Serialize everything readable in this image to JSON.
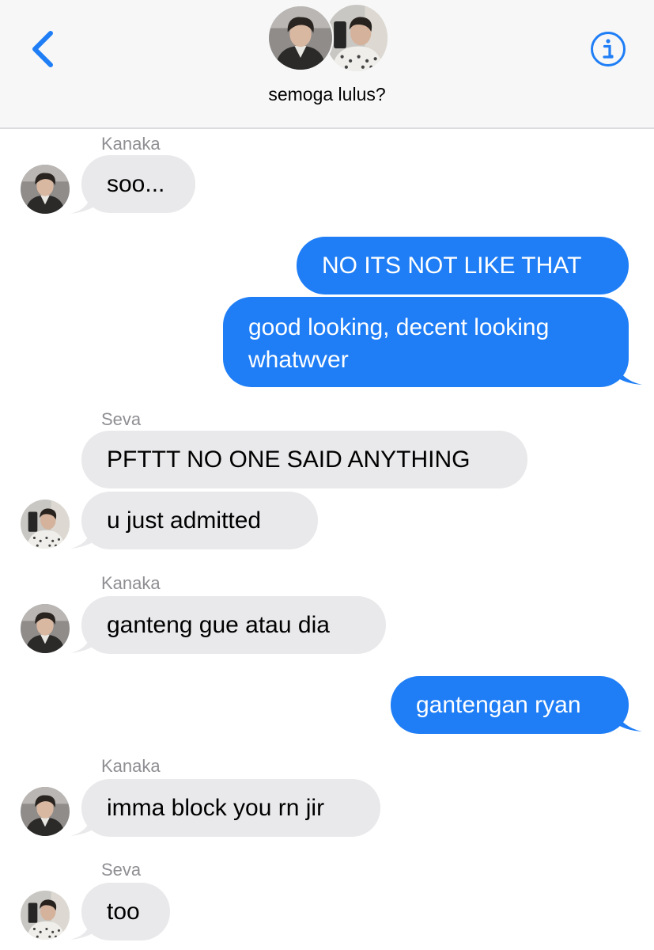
{
  "header": {
    "group_name": "semoga lulus?",
    "accent_color": "#1f7ef6",
    "back_icon": "chevron-left-icon",
    "info_icon": "info-circle-icon"
  },
  "messages": [
    {
      "direction": "incoming",
      "sender": "Kanaka",
      "text": "soo...",
      "tail": true
    },
    {
      "direction": "outgoing",
      "text": "NO ITS NOT LIKE THAT",
      "tail": false
    },
    {
      "direction": "outgoing",
      "text_lines": [
        "good looking, decent looking",
        "whatwver"
      ],
      "tail": true
    },
    {
      "direction": "incoming",
      "sender": "Seva",
      "text": "PFTTT NO ONE SAID ANYTHING",
      "tail": false
    },
    {
      "direction": "incoming",
      "text": "u just admitted",
      "tail": true
    },
    {
      "direction": "incoming",
      "sender": "Kanaka",
      "text": "ganteng gue atau dia",
      "tail": true
    },
    {
      "direction": "outgoing",
      "text": "gantengan ryan",
      "tail": true
    },
    {
      "direction": "incoming",
      "sender": "Kanaka",
      "text": "imma block you rn jir",
      "tail": true
    },
    {
      "direction": "incoming",
      "sender": "Seva",
      "text": "too",
      "tail": true
    }
  ],
  "colors": {
    "incoming_bubble": "#e9e9eb",
    "outgoing_bubble": "#1f7ef6",
    "sender_label": "#8e8e93"
  }
}
